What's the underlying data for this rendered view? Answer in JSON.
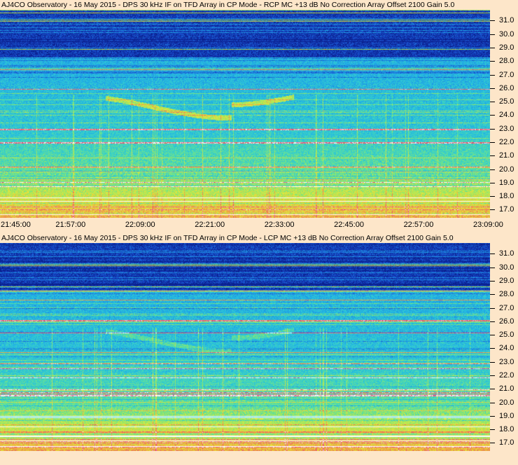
{
  "chart_data": [
    {
      "type": "heatmap",
      "title": "AJ4CO Observatory - 16 May 2015 - DPS 30 kHz IF on TFD Array in CP Mode - RCP  MC +13 dB  No Correction Array  Offset 2100   Gain 5.0",
      "ylabel": "",
      "xlabel": "",
      "y_ticks": [
        "31.0",
        "30.0",
        "29.0",
        "28.0",
        "27.0",
        "26.0",
        "25.0",
        "24.0",
        "23.0",
        "22.0",
        "21.0",
        "20.0",
        "19.0",
        "18.0",
        "17.0"
      ],
      "ylim": [
        16.4,
        31.8
      ],
      "x_ticks": [
        "21:45:00",
        "21:57:00",
        "22:09:00",
        "22:21:00",
        "22:33:00",
        "22:45:00",
        "22:57:00",
        "23:09:00"
      ],
      "colormap": [
        "#0a1f8c",
        "#1746c8",
        "#1e86e0",
        "#21b6e6",
        "#3fd6c0",
        "#8ee86a",
        "#e4e63c",
        "#f0a040",
        "#e8407a",
        "#ffffff"
      ]
    },
    {
      "type": "heatmap",
      "title": "AJ4CO Observatory - 16 May 2015 - DPS 30 kHz IF on TFD Array in CP Mode - LCP  MC +13 dB  No Correction Array  Offset 2100   Gain 5.0",
      "ylabel": "",
      "xlabel": "",
      "y_ticks": [
        "31.0",
        "30.0",
        "29.0",
        "28.0",
        "27.0",
        "26.0",
        "25.0",
        "24.0",
        "23.0",
        "22.0",
        "21.0",
        "20.0",
        "19.0",
        "18.0",
        "17.0"
      ],
      "ylim": [
        16.4,
        31.8
      ],
      "x_ticks": [
        "21:45:00",
        "21:57:00",
        "22:09:00",
        "22:21:00",
        "22:33:00",
        "22:45:00",
        "22:57:00",
        "23:09:00"
      ],
      "colormap": [
        "#0a1f8c",
        "#1746c8",
        "#1e86e0",
        "#21b6e6",
        "#3fd6c0",
        "#8ee86a",
        "#e4e63c",
        "#f0a040",
        "#e8407a",
        "#ffffff"
      ]
    }
  ]
}
